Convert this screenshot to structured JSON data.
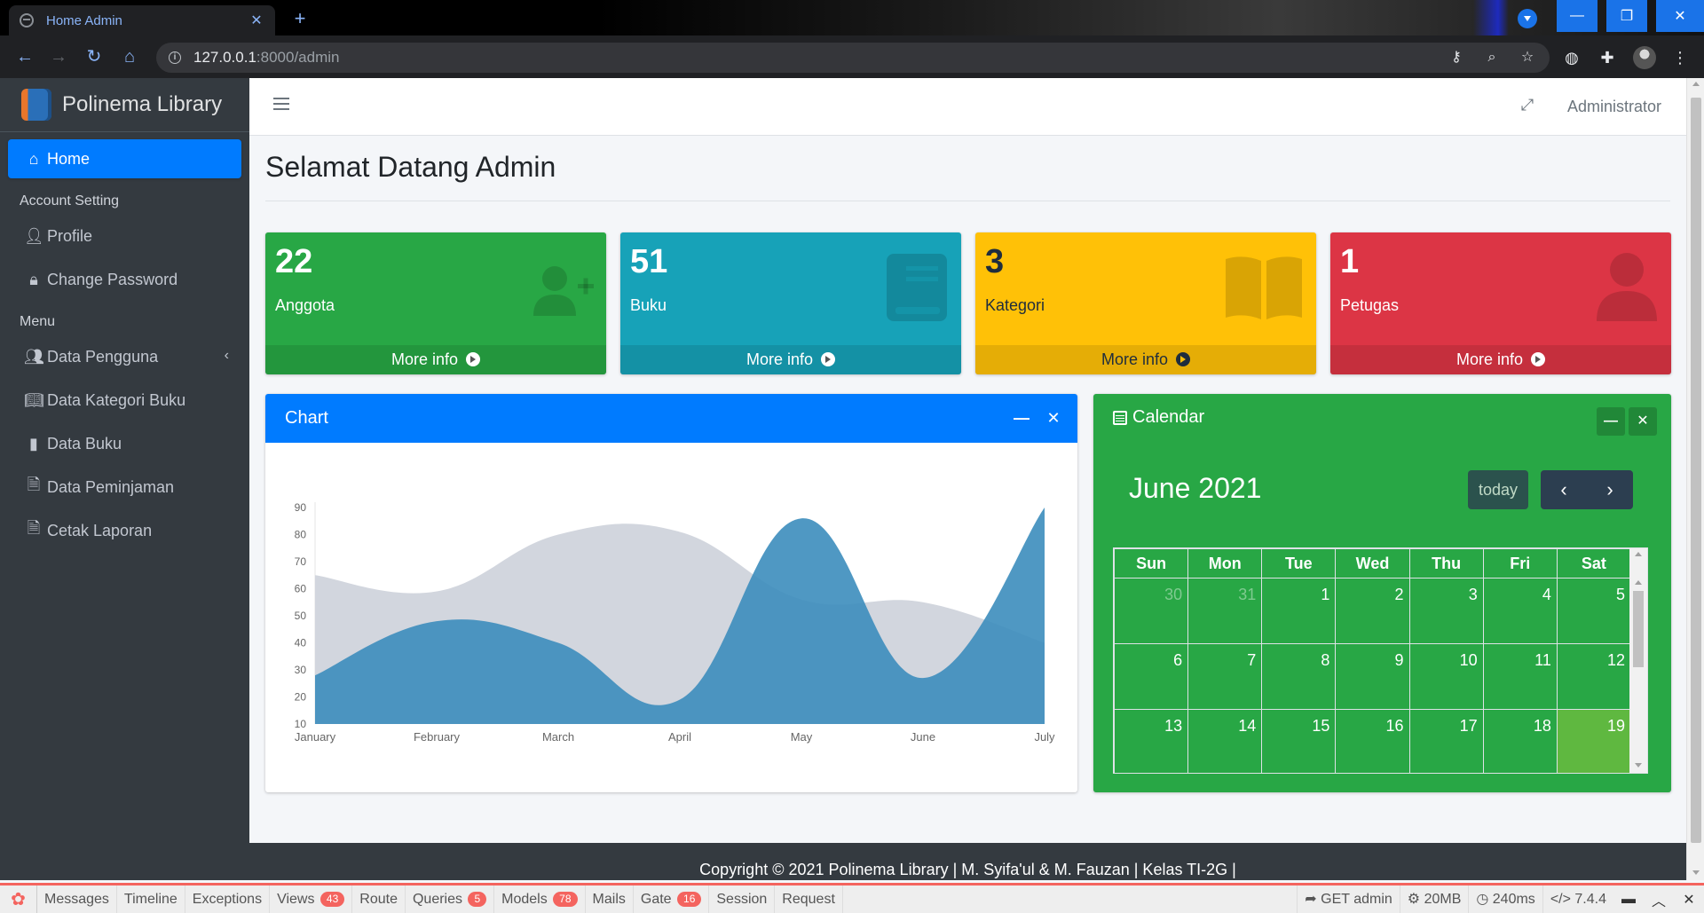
{
  "browser": {
    "tab_title": "Home Admin",
    "url_host": "127.0.0.1",
    "url_rest": ":8000/admin"
  },
  "sidebar": {
    "brand": "Polinema Library",
    "home": "Home",
    "header_account": "Account Setting",
    "profile": "Profile",
    "change_password": "Change Password",
    "header_menu": "Menu",
    "data_pengguna": "Data Pengguna",
    "data_kategori": "Data Kategori Buku",
    "data_buku": "Data Buku",
    "data_peminjaman": "Data Peminjaman",
    "cetak_laporan": "Cetak Laporan"
  },
  "header": {
    "user": "Administrator"
  },
  "page": {
    "title": "Selamat Datang Admin"
  },
  "stats": [
    {
      "value": "22",
      "label": "Anggota",
      "more": "More info",
      "icon": "user-plus-icon",
      "color": "#28a745"
    },
    {
      "value": "51",
      "label": "Buku",
      "more": "More info",
      "icon": "book-icon",
      "color": "#17a2b8"
    },
    {
      "value": "3",
      "label": "Kategori",
      "more": "More info",
      "icon": "book-open-icon",
      "color": "#ffc107"
    },
    {
      "value": "1",
      "label": "Petugas",
      "more": "More info",
      "icon": "user-icon",
      "color": "#dc3545"
    }
  ],
  "chart_card": {
    "title": "Chart"
  },
  "chart_data": {
    "type": "area",
    "categories": [
      "January",
      "February",
      "March",
      "April",
      "May",
      "June",
      "July"
    ],
    "series": [
      {
        "values": [
          65,
          59,
          80,
          81,
          56,
          55,
          40
        ],
        "color": "#d2d6de"
      },
      {
        "values": [
          28,
          48,
          40,
          19,
          86,
          27,
          90
        ],
        "color": "#3c8dbc"
      }
    ],
    "ylim": [
      10,
      90
    ],
    "yticks": [
      10,
      20,
      30,
      40,
      50,
      60,
      70,
      80,
      90
    ]
  },
  "calendar": {
    "title": "Calendar",
    "month": "June 2021",
    "today_label": "today",
    "weekdays": [
      "Sun",
      "Mon",
      "Tue",
      "Wed",
      "Thu",
      "Fri",
      "Sat"
    ],
    "weeks": [
      [
        "30",
        "31",
        "1",
        "2",
        "3",
        "4",
        "5"
      ],
      [
        "6",
        "7",
        "8",
        "9",
        "10",
        "11",
        "12"
      ],
      [
        "13",
        "14",
        "15",
        "16",
        "17",
        "18",
        "19"
      ]
    ],
    "today": "19"
  },
  "footer": {
    "text": "Copyright © 2021 Polinema Library | M. Syifa'ul & M. Fauzan | Kelas TI-2G |"
  },
  "debugbar": {
    "tabs": [
      {
        "label": "Messages"
      },
      {
        "label": "Timeline"
      },
      {
        "label": "Exceptions"
      },
      {
        "label": "Views",
        "badge": "43"
      },
      {
        "label": "Route"
      },
      {
        "label": "Queries",
        "badge": "5"
      },
      {
        "label": "Models",
        "badge": "78"
      },
      {
        "label": "Mails"
      },
      {
        "label": "Gate",
        "badge": "16"
      },
      {
        "label": "Session"
      },
      {
        "label": "Request"
      }
    ],
    "request": "GET admin",
    "memory": "20MB",
    "time": "240ms",
    "php": "7.4.4"
  }
}
